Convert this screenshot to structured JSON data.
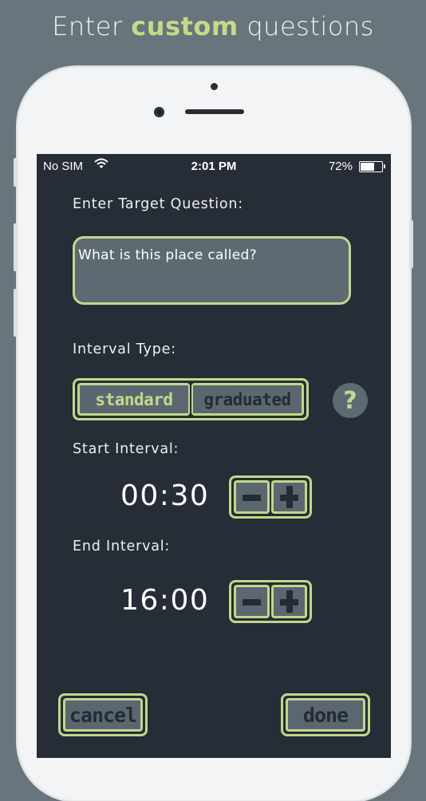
{
  "headline": {
    "prefix": "Enter",
    "accent": "custom",
    "suffix": "questions"
  },
  "status_bar": {
    "carrier": "No SIM",
    "time": "2:01 PM",
    "battery": "72%",
    "battery_level": 0.72
  },
  "form": {
    "question_label": "Enter Target Question:",
    "question_value": "What is this place called?",
    "interval_type_label": "Interval Type:",
    "interval_options": [
      "standard",
      "graduated"
    ],
    "help_label": "?",
    "start_label": "Start Interval:",
    "start_value": "00:30",
    "end_label": "End Interval:",
    "end_value": "16:00"
  },
  "actions": {
    "cancel": "cancel",
    "done": "done"
  },
  "colors": {
    "accent": "#c5d98b",
    "background": "#262d36",
    "button_fill": "#5b6770"
  },
  "icons": {
    "wifi": "wifi-icon",
    "battery": "battery-icon",
    "minus": "minus-icon",
    "plus": "plus-icon"
  }
}
